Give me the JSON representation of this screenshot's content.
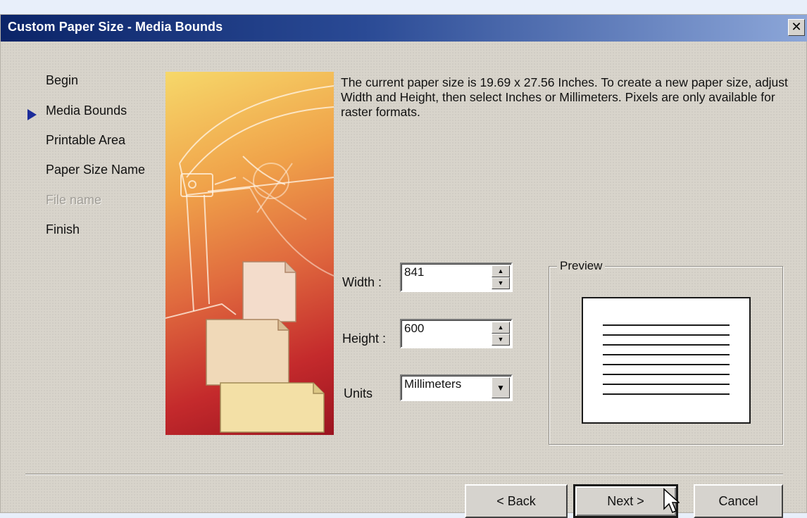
{
  "window": {
    "title": "Custom Paper Size - Media Bounds",
    "close_label": "✕"
  },
  "steps": [
    {
      "label": "Begin",
      "state": "normal"
    },
    {
      "label": "Media Bounds",
      "state": "current"
    },
    {
      "label": "Printable Area",
      "state": "normal"
    },
    {
      "label": "Paper Size Name",
      "state": "normal"
    },
    {
      "label": "File name",
      "state": "disabled"
    },
    {
      "label": "Finish",
      "state": "normal"
    }
  ],
  "description": "The current paper size is 19.69 x 27.56 Inches. To create a new paper size, adjust Width and Height, then select Inches or Millimeters. Pixels are only available for raster formats.",
  "form": {
    "width_label": "Width :",
    "width_value": "841",
    "height_label": "Height :",
    "height_value": "600",
    "units_label": "Units",
    "units_value": "Millimeters"
  },
  "preview": {
    "title": "Preview"
  },
  "buttons": {
    "back": "< Back",
    "next": "Next >",
    "cancel": "Cancel"
  },
  "colors": {
    "titlebar_start": "#0b2468",
    "titlebar_end": "#8da7d9",
    "dialog_bg": "#d8d4cb",
    "step_arrow": "#1c2c9a"
  },
  "icons": {
    "close": "close-icon",
    "spin_up": "up-arrow-icon",
    "spin_down": "down-arrow-icon",
    "combo": "dropdown-arrow-icon",
    "current_step": "triangle-right-icon"
  }
}
